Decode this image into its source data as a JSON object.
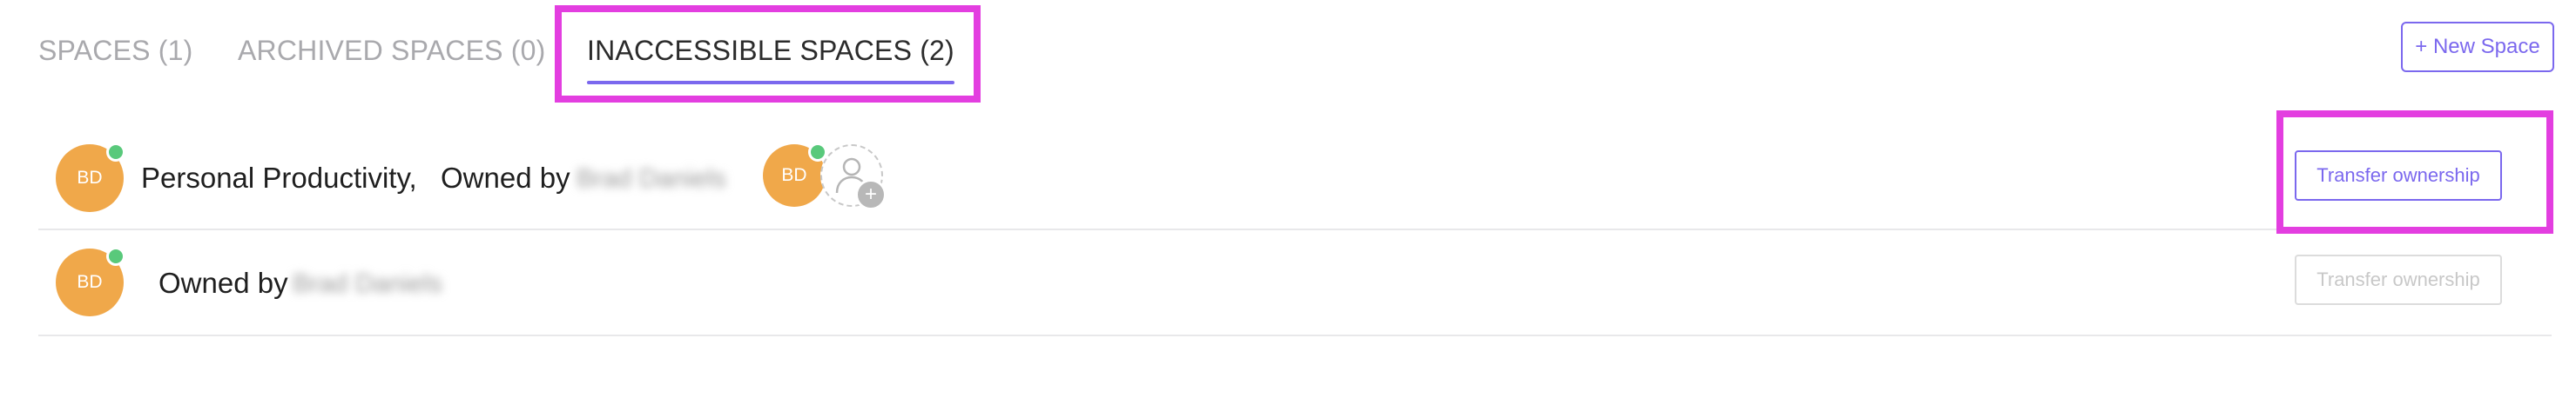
{
  "tabs": [
    {
      "label": "SPACES (1)",
      "active": false
    },
    {
      "label": "ARCHIVED SPACES (0)",
      "active": false
    },
    {
      "label": "INACCESSIBLE SPACES (2)",
      "active": true
    }
  ],
  "new_space_label": "+ New Space",
  "rows": [
    {
      "avatar_initials": "BD",
      "space_name": "Personal Productivity,",
      "owned_by_label": "Owned by",
      "owner_name": "Brad Daniels",
      "member_avatar_initials": "BD",
      "transfer_label": "Transfer ownership",
      "transfer_enabled": true
    },
    {
      "avatar_initials": "BD",
      "space_name": "",
      "owned_by_label": "Owned by",
      "owner_name": "Brad Daniels",
      "transfer_label": "Transfer ownership",
      "transfer_enabled": false
    }
  ],
  "colors": {
    "accent": "#7b68ee",
    "highlight": "#e33ee0",
    "avatar": "#f0a84a",
    "online": "#59c97b"
  }
}
